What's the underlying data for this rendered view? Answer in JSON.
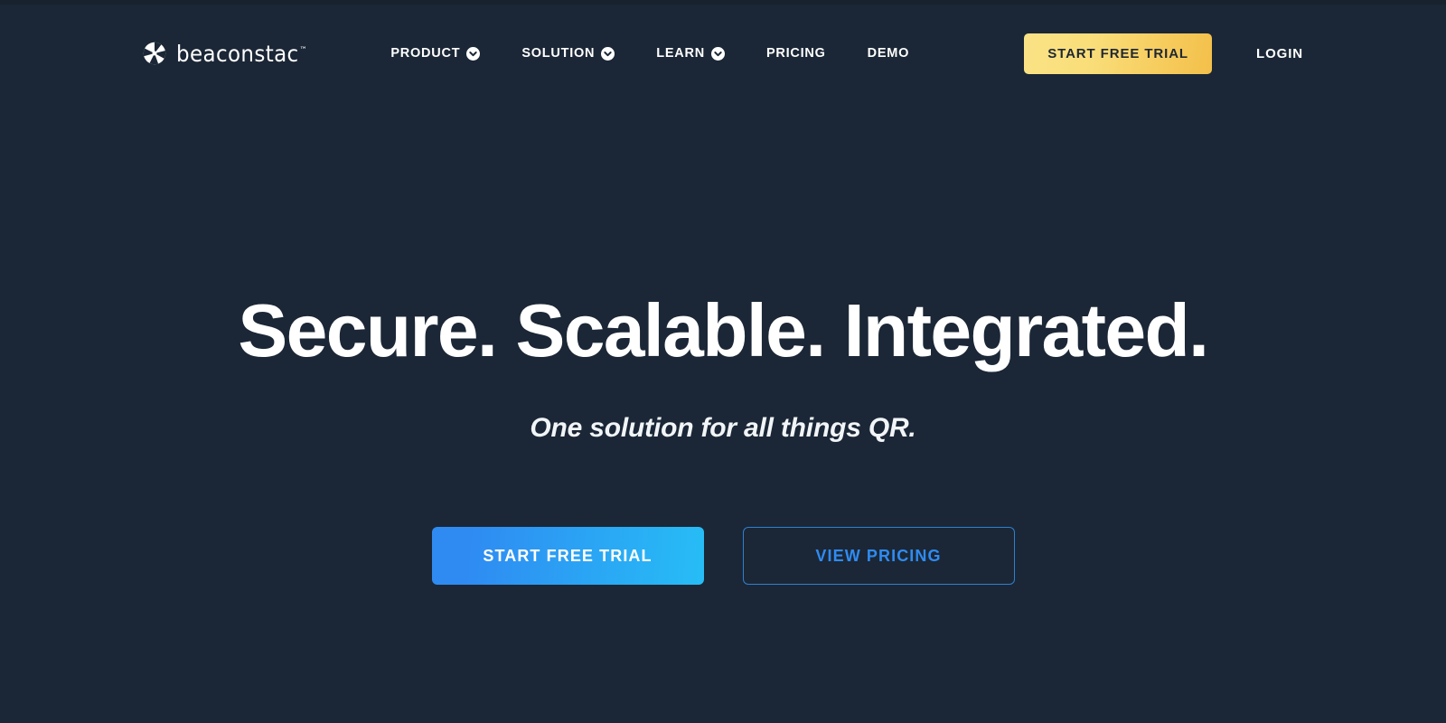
{
  "page": {
    "background_color": "#1b2736"
  },
  "header": {
    "logo": {
      "icon": "beaconstac-aperture-icon",
      "wordmark": "beaconstac",
      "trademark": "™"
    },
    "nav_items": [
      {
        "label": "PRODUCT",
        "has_dropdown": true,
        "icon": "chevron-down-circle-icon"
      },
      {
        "label": "SOLUTION",
        "has_dropdown": true,
        "icon": "chevron-down-circle-icon"
      },
      {
        "label": "LEARN",
        "has_dropdown": true,
        "icon": "chevron-down-circle-icon"
      },
      {
        "label": "PRICING",
        "has_dropdown": false,
        "icon": ""
      },
      {
        "label": "DEMO",
        "has_dropdown": false,
        "icon": ""
      }
    ],
    "trial_button": {
      "label": "START FREE TRIAL",
      "gradient_start": "#fae386",
      "gradient_end": "#f3c04a",
      "text_color": "#1f2733"
    },
    "login_link": {
      "label": "LOGIN",
      "color": "#ffffff"
    }
  },
  "hero": {
    "title": "Secure. Scalable. Integrated.",
    "subtitle": "One solution for all things QR.",
    "primary_button": {
      "label": "START FREE TRIAL",
      "gradient_start": "#2f8bf2",
      "gradient_end": "#27bdf6",
      "text_color": "#ffffff"
    },
    "secondary_button": {
      "label": "VIEW PRICING",
      "border_color": "#2f7fd0",
      "text_color": "#2f8bf2"
    }
  }
}
